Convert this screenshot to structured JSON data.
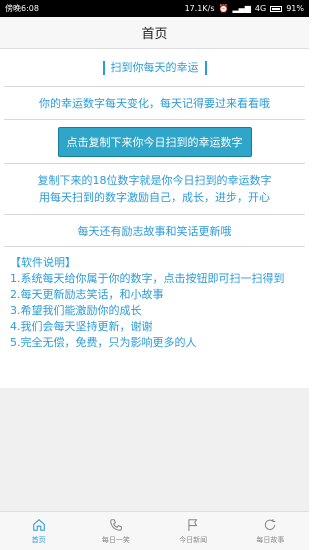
{
  "status": {
    "time": "傍晚6:08",
    "speed": "17.1K/s",
    "network": "4G",
    "battery": "91%"
  },
  "header": {
    "title": "首页"
  },
  "main": {
    "scan_title": "扫到你每天的幸运",
    "subtitle": "你的幸运数字每天变化，每天记得要过来看看哦",
    "copy_button": "点击复制下来你今日扫到的幸运数字",
    "info_line1": "复制下来的18位数字就是你今日扫到的幸运数字",
    "info_line2": "用每天扫到的数字激励自己，成长，进步，开心",
    "encourage": "每天还有励志故事和笑话更新哦"
  },
  "description": {
    "heading": "【软件说明】",
    "items": [
      "1.系统每天给你属于你的数字，点击按钮即可扫一扫得到",
      "2.每天更新励志笑话，和小故事",
      "3.希望我们能激励你的成长",
      "4.我们会每天坚持更新，谢谢",
      "5.完全无偿，免费，只为影响更多的人"
    ]
  },
  "tabs": [
    {
      "label": "首页",
      "icon": "home-icon",
      "active": true
    },
    {
      "label": "每日一笑",
      "icon": "phone-icon",
      "active": false
    },
    {
      "label": "今日新闻",
      "icon": "flag-icon",
      "active": false
    },
    {
      "label": "每日故事",
      "icon": "refresh-icon",
      "active": false
    }
  ],
  "colors": {
    "accent": "#2b9bd8",
    "button_bg": "#2fa6c9",
    "tab_inactive": "#888888"
  }
}
